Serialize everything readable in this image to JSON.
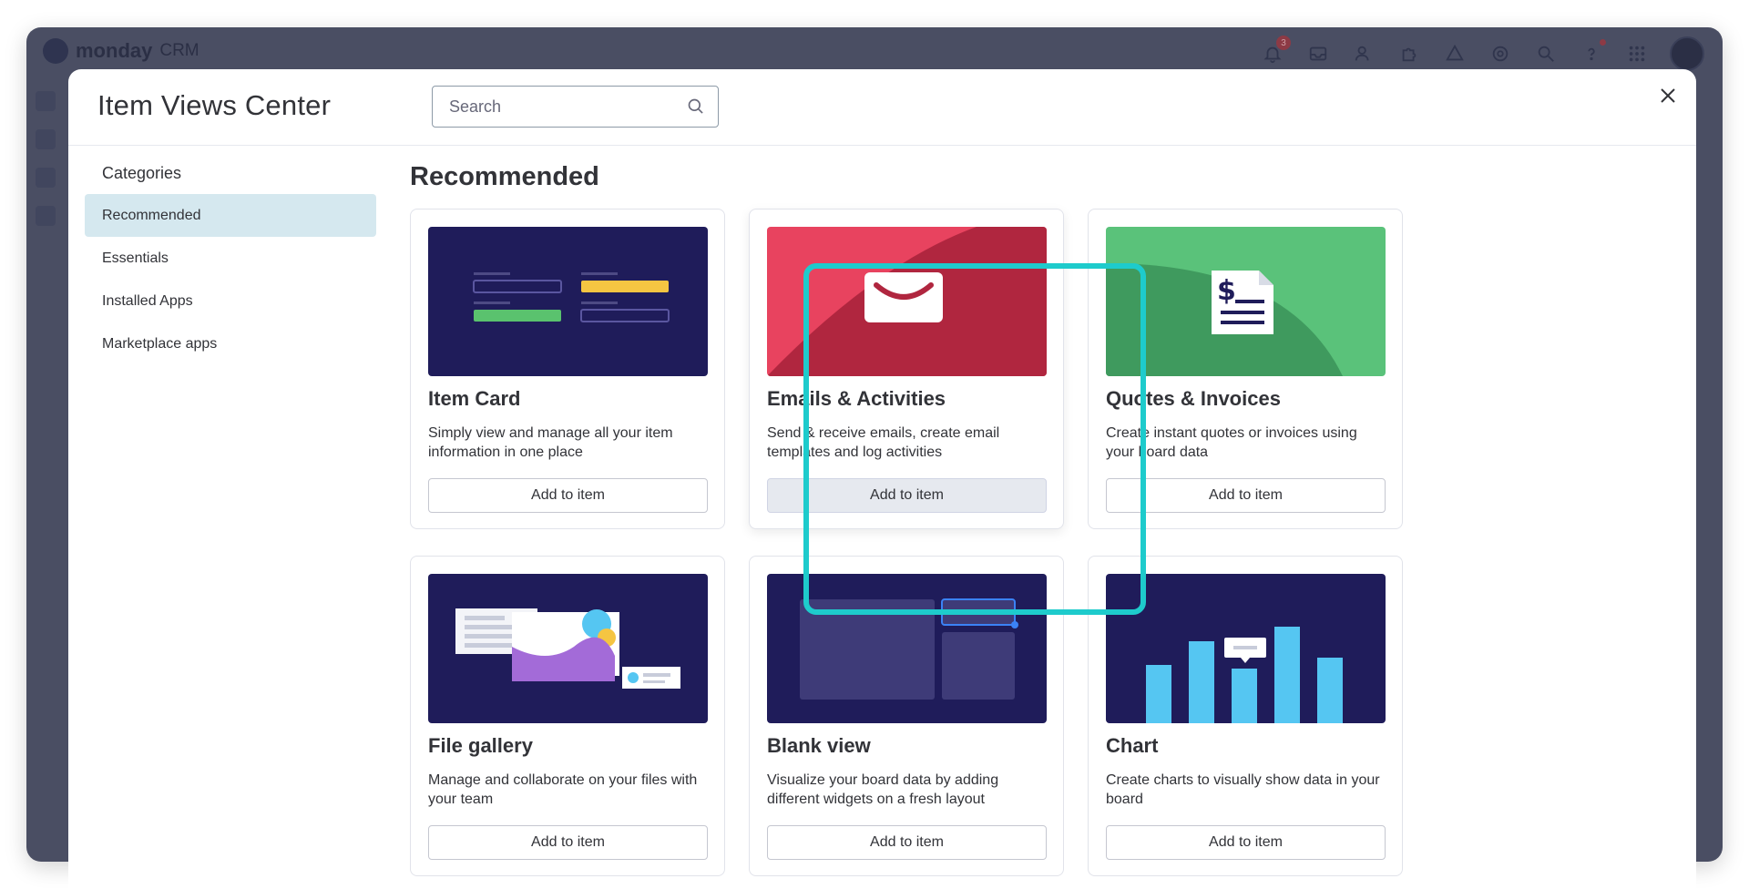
{
  "app": {
    "brand_name": "monday",
    "brand_suffix": "CRM",
    "notification_count": "3"
  },
  "modal": {
    "title": "Item Views Center",
    "search_placeholder": "Search"
  },
  "sidebar": {
    "title": "Categories",
    "items": [
      {
        "label": "Recommended",
        "active": true
      },
      {
        "label": "Essentials",
        "active": false
      },
      {
        "label": "Installed Apps",
        "active": false
      },
      {
        "label": "Marketplace apps",
        "active": false
      }
    ]
  },
  "main": {
    "section_title": "Recommended",
    "cards": [
      {
        "title": "Item Card",
        "description": "Simply view and manage all your item information in one place",
        "button": "Add to item",
        "thumb_icon": "item-card-thumbnail"
      },
      {
        "title": "Emails & Activities",
        "description": "Send & receive emails, create email templates and log activities",
        "button": "Add to item",
        "thumb_icon": "email-envelope-thumbnail"
      },
      {
        "title": "Quotes & Invoices",
        "description": "Create instant quotes or invoices using your board data",
        "button": "Add to item",
        "thumb_icon": "invoice-dollar-thumbnail"
      },
      {
        "title": "File gallery",
        "description": "Manage and collaborate on your files with your team",
        "button": "Add to item",
        "thumb_icon": "file-gallery-thumbnail"
      },
      {
        "title": "Blank view",
        "description": "Visualize your board data by adding different widgets on a fresh layout",
        "button": "Add to item",
        "thumb_icon": "blank-view-thumbnail"
      },
      {
        "title": "Chart",
        "description": "Create charts to visually show data in your board",
        "button": "Add to item",
        "thumb_icon": "bar-chart-thumbnail"
      }
    ]
  },
  "colors": {
    "highlight": "#1ecbcc",
    "active_category": "#d5e8ef",
    "thumb_navy": "#1f1c5a"
  }
}
